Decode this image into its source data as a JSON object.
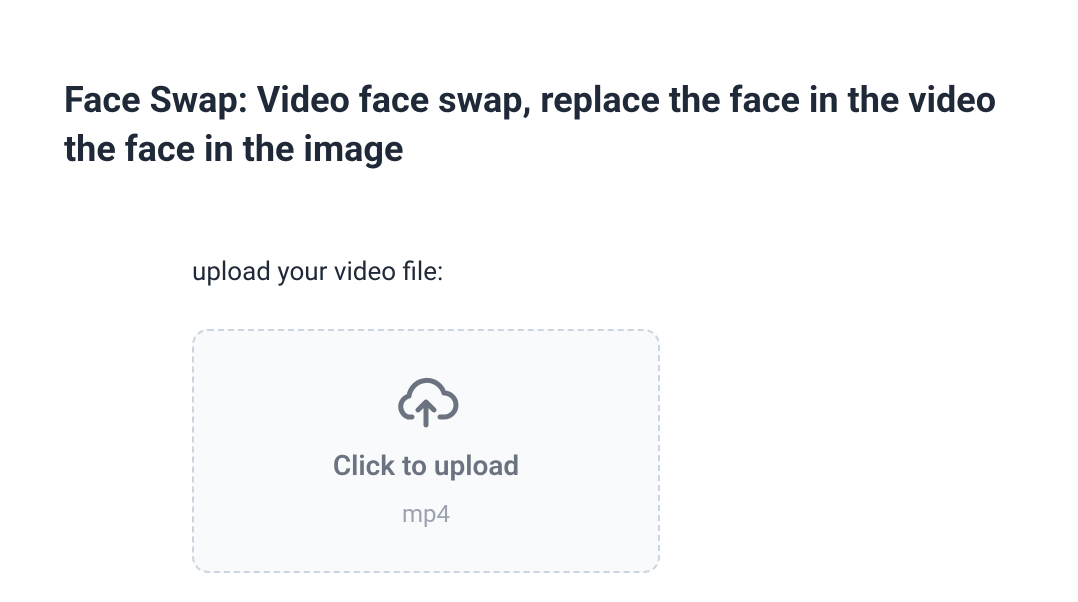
{
  "heading": "Face Swap: Video face swap, replace the face in the video the face in the image",
  "upload": {
    "label": "upload your video file:",
    "primaryText": "Click to upload",
    "acceptedFormat": "mp4"
  }
}
